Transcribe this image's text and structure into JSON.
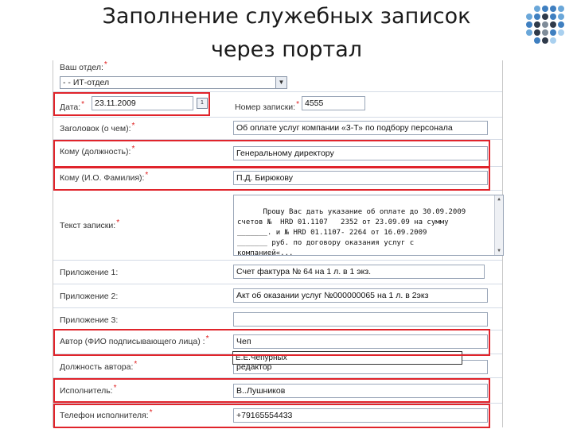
{
  "slide": {
    "title_line1": "Заполнение служебных записок",
    "title_line2": "через портал",
    "logo_colors": [
      "#6aa7d9",
      "#3f7fc0",
      "#2f3a4a",
      "#7f8c99",
      "#a9d0ef"
    ]
  },
  "form": {
    "department": {
      "label": "Ваш отдел:",
      "required": "*",
      "value": "- - ИТ-отдел",
      "arrow": "▼"
    },
    "date": {
      "label": "Дата:",
      "required": "*",
      "value": "23.11.2009",
      "button_icon": "calendar-icon",
      "button_glyph": "1"
    },
    "note_number": {
      "label": "Номер записки:",
      "required": "*",
      "value": "4555"
    },
    "subject": {
      "label": "Заголовок (о чем):",
      "required": "*",
      "value": "Об оплате услуг компании «3-Т» по подбору персонала"
    },
    "to_position": {
      "label": "Кому (должность):",
      "required": "*",
      "value": "Генеральному директору"
    },
    "to_name": {
      "label": "Кому (И.О. Фамилия):",
      "required": "*",
      "value": "П.Д. Бирюкову"
    },
    "body_text": {
      "label": "Текст записки:",
      "required": "*",
      "value": "Прошу Вас дать указание об оплате до 30.09.2009\nсчетов №  HRD 01.1107   2352 от 23.09.09 на сумму\n_______. и № HRD 01.1107- 2264 от 16.09.2009\n_______ руб. по договору оказания услуг с\nкомпанией«...",
      "scroll_up": "▲",
      "scroll_down": "▼"
    },
    "attachment1": {
      "label": "Приложение 1:",
      "value": "Счет фактура № 64 на 1 л. в 1 экз."
    },
    "attachment2": {
      "label": "Приложение 2:",
      "value": "Акт об оказании услуг №000000065 на 1 л. в 2экз"
    },
    "attachment3": {
      "label": "Приложение 3:",
      "value": ""
    },
    "author": {
      "label": "Автор (ФИО подписывающего лица) :",
      "required": "*",
      "value": "Чеп",
      "suggestion": "Е.Е.Чепурных"
    },
    "author_position": {
      "label": "Должность автора:",
      "required": "*",
      "value": "редактор"
    },
    "executor": {
      "label": "Исполнитель:",
      "required": "*",
      "value": "В..Лушников"
    },
    "executor_phone": {
      "label": "Телефон исполнителя:",
      "required": "*",
      "value": "+79165554433"
    }
  }
}
